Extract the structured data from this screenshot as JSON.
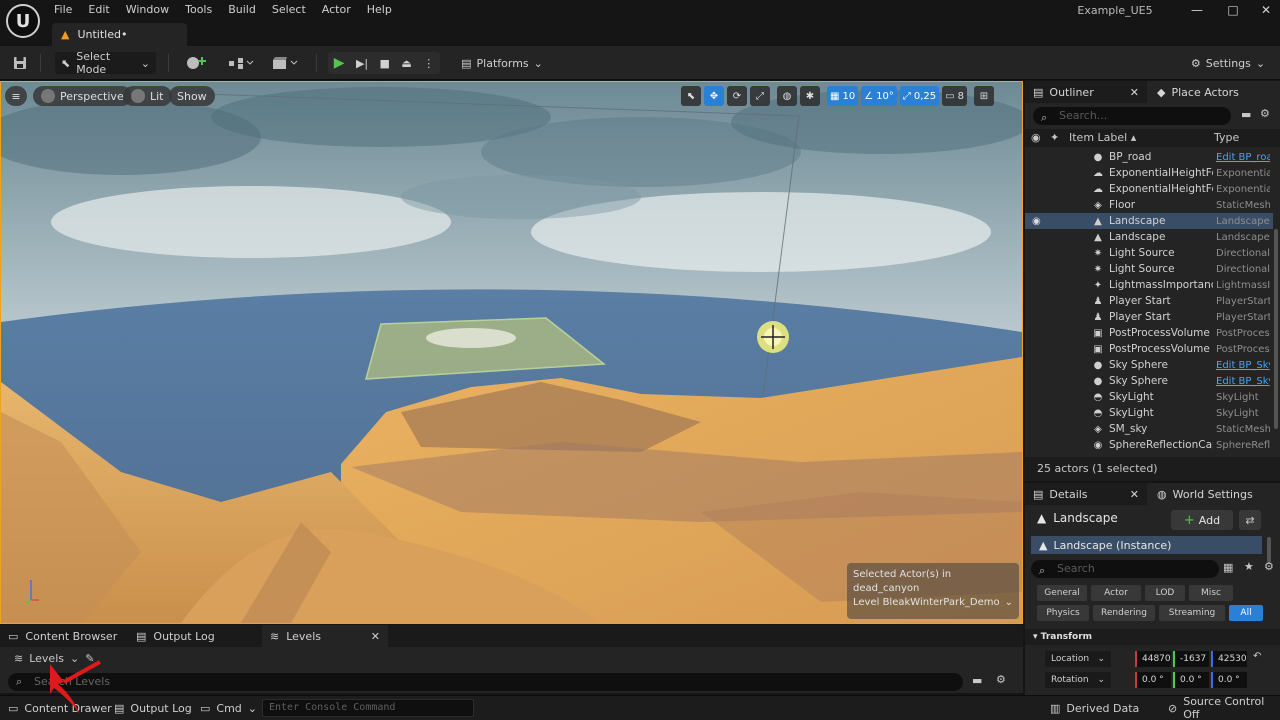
{
  "menu": [
    "File",
    "Edit",
    "Window",
    "Tools",
    "Build",
    "Select",
    "Actor",
    "Help"
  ],
  "document_tab": "Untitled•",
  "project_name": "Example_UE5",
  "toolbar": {
    "select_mode": "Select Mode",
    "platforms": "Platforms",
    "settings": "Settings"
  },
  "viewport": {
    "perspective": "Perspective",
    "lit": "Lit",
    "show": "Show",
    "grid_snap": "10",
    "rotation_snap": "10°",
    "scale_snap": "0,25",
    "camera_speed": "8",
    "selection_info": {
      "line1": "Selected Actor(s) in",
      "line2": "dead_canyon",
      "line3": "Level  BleakWinterPark_Demo"
    }
  },
  "bottom_tabs": [
    "Content Browser",
    "Output Log",
    "Levels"
  ],
  "levels": {
    "label": "Levels",
    "search_placeholder": "Search Levels"
  },
  "statusbar": {
    "content_drawer": "Content Drawer",
    "output_log": "Output Log",
    "cmd": "Cmd",
    "console_placeholder": "Enter Console Command",
    "derived_data": "Derived Data",
    "source_control": "Source Control Off"
  },
  "outliner": {
    "tab": "Outliner",
    "place_actors": "Place Actors",
    "search_placeholder": "Search...",
    "col_label": "Item Label",
    "col_type": "Type",
    "rows": [
      {
        "icon": "blueprint-icon",
        "glyph": "●",
        "label": "BP_road",
        "type": "Edit BP_road",
        "link": true
      },
      {
        "icon": "fog-icon",
        "glyph": "☁",
        "label": "ExponentialHeightFog",
        "type": "ExponentialHeightFog",
        "link": false
      },
      {
        "icon": "fog-icon",
        "glyph": "☁",
        "label": "ExponentialHeightFog",
        "type": "ExponentialHeightFog",
        "link": false
      },
      {
        "icon": "mesh-icon",
        "glyph": "◈",
        "label": "Floor",
        "type": "StaticMeshActor",
        "link": false
      },
      {
        "icon": "landscape-icon",
        "glyph": "▲",
        "label": "Landscape",
        "type": "Landscape",
        "link": false,
        "selected": true
      },
      {
        "icon": "landscape-icon",
        "glyph": "▲",
        "label": "Landscape",
        "type": "Landscape",
        "link": false
      },
      {
        "icon": "light-icon",
        "glyph": "✷",
        "label": "Light Source",
        "type": "DirectionalLight",
        "link": false
      },
      {
        "icon": "light-icon",
        "glyph": "✷",
        "label": "Light Source",
        "type": "DirectionalLight",
        "link": false
      },
      {
        "icon": "lightmass-icon",
        "glyph": "✦",
        "label": "LightmassImportance",
        "type": "LightmassImportanceVolume",
        "link": false
      },
      {
        "icon": "player-start-icon",
        "glyph": "♟",
        "label": "Player Start",
        "type": "PlayerStart",
        "link": false
      },
      {
        "icon": "player-start-icon",
        "glyph": "♟",
        "label": "Player Start",
        "type": "PlayerStart",
        "link": false
      },
      {
        "icon": "volume-icon",
        "glyph": "▣",
        "label": "PostProcessVolume",
        "type": "PostProcessVolume",
        "link": false
      },
      {
        "icon": "volume-icon",
        "glyph": "▣",
        "label": "PostProcessVolume",
        "type": "PostProcessVolume",
        "link": false
      },
      {
        "icon": "blueprint-icon",
        "glyph": "●",
        "label": "Sky Sphere",
        "type": "Edit BP_Sky_Sphere",
        "link": true
      },
      {
        "icon": "blueprint-icon",
        "glyph": "●",
        "label": "Sky Sphere",
        "type": "Edit BP_Sky_Sphere",
        "link": true
      },
      {
        "icon": "skylight-icon",
        "glyph": "◓",
        "label": "SkyLight",
        "type": "SkyLight",
        "link": false
      },
      {
        "icon": "skylight-icon",
        "glyph": "◓",
        "label": "SkyLight",
        "type": "SkyLight",
        "link": false
      },
      {
        "icon": "mesh-icon",
        "glyph": "◈",
        "label": "SM_sky",
        "type": "StaticMeshActor",
        "link": false
      },
      {
        "icon": "reflection-icon",
        "glyph": "◉",
        "label": "SphereReflectionCapture",
        "type": "SphereReflectionCapture",
        "link": false
      }
    ],
    "actor_count": "25 actors (1 selected)"
  },
  "details": {
    "tab": "Details",
    "world_settings": "World Settings",
    "title": "Landscape",
    "add": "Add",
    "instance": "Landscape (Instance)",
    "search_placeholder": "Search",
    "categories": [
      "General",
      "Actor",
      "LOD",
      "Misc",
      "Physics",
      "Rendering",
      "Streaming",
      "All"
    ],
    "transform": "Transform",
    "location_label": "Location",
    "rotation_label": "Rotation",
    "location": [
      "44870",
      "-1637",
      "42530"
    ],
    "rotation": [
      "0.0 °",
      "0.0 °",
      "0.0 °"
    ]
  },
  "colors": {
    "accent_orange": "#f1a11b",
    "selection_blue": "#2a7fd6",
    "play_green": "#52c452"
  }
}
